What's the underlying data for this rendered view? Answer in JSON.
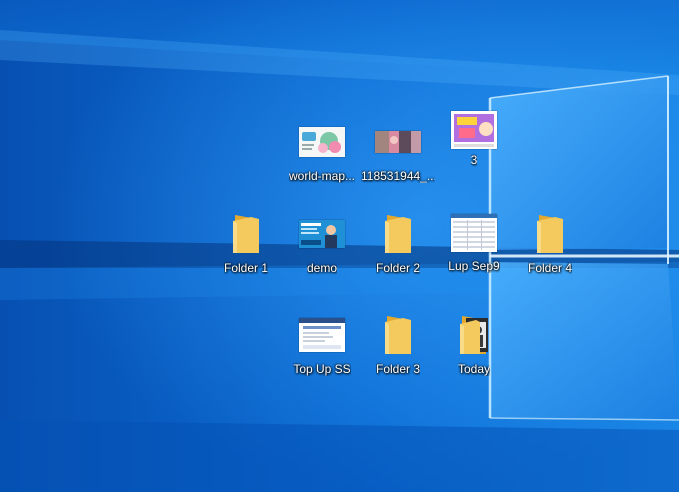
{
  "desktop": {
    "icons": [
      {
        "label": "world-map...",
        "kind": "image-thumb-flowers"
      },
      {
        "label": "118531944_...",
        "kind": "image-thumb-photo"
      },
      {
        "label": "3",
        "kind": "image-thumb-banner"
      },
      {
        "label": "Folder 1",
        "kind": "folder-icon"
      },
      {
        "label": "demo",
        "kind": "image-thumb-promo"
      },
      {
        "label": "Folder 2",
        "kind": "folder-icon"
      },
      {
        "label": "Lup Sep9",
        "kind": "image-thumb-table"
      },
      {
        "label": "Folder 4",
        "kind": "folder-icon"
      },
      {
        "label": "Top Up SS",
        "kind": "image-thumb-webpage"
      },
      {
        "label": "Folder 3",
        "kind": "folder-icon"
      },
      {
        "label": "Today",
        "kind": "folder-with-photo-icon"
      }
    ]
  },
  "colors": {
    "wallpaper_dark": "#0345a0",
    "wallpaper_light": "#2a9bf0",
    "folder_yellow": "#f4c95d",
    "folder_back": "#e3a92e"
  }
}
